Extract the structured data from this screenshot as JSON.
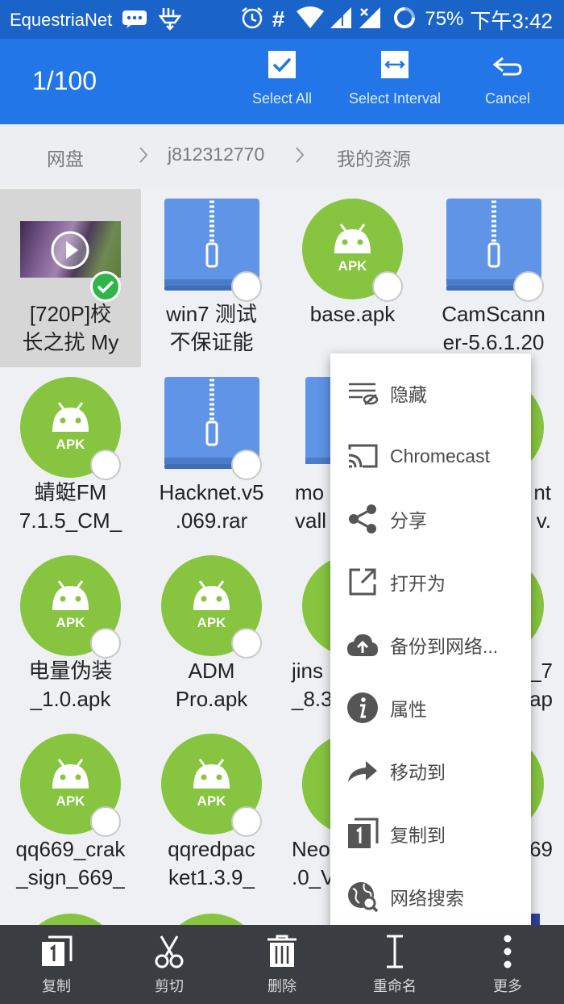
{
  "status_bar": {
    "carrier": "EquestriaNet",
    "battery": "75%",
    "time": "下午3:42",
    "hash": "#"
  },
  "action_bar": {
    "count": "1/100",
    "select_all": "Select All",
    "select_interval": "Select Interval",
    "cancel": "Cancel"
  },
  "breadcrumb": [
    "网盘",
    "j812312770",
    "我的资源"
  ],
  "files": [
    {
      "name": "[720P]校\n长之扰 My",
      "type": "video",
      "selected": true
    },
    {
      "name": "win7 测试\n不保证能",
      "type": "zip"
    },
    {
      "name": "base.apk",
      "type": "apk"
    },
    {
      "name": "CamScann\ner-5.6.1.20",
      "type": "zip"
    },
    {
      "name": "蜻蜓FM\n7.1.5_CM_",
      "type": "apk"
    },
    {
      "name": "Hacknet.v5\n.069.rar",
      "type": "zip"
    },
    {
      "name": "mo\nvall",
      "type": "zip"
    },
    {
      "name": "nt\nv.",
      "type": "apk"
    },
    {
      "name": "电量伪装\n_1.0.apk",
      "type": "apk"
    },
    {
      "name": "ADM\nPro.apk",
      "type": "apk"
    },
    {
      "name": "jins\n_8.3",
      "type": "apk"
    },
    {
      "name": "_7\nap",
      "type": "apk"
    },
    {
      "name": "qq669_crak\n_sign_669_",
      "type": "apk"
    },
    {
      "name": "qqredpac\nket1.3.9_",
      "type": "apk"
    },
    {
      "name": "Neo\n.0_V",
      "type": "apk"
    },
    {
      "name": "69",
      "type": "apk"
    }
  ],
  "menu": [
    {
      "label": "隐藏",
      "icon": "hide-icon"
    },
    {
      "label": "Chromecast",
      "icon": "cast-icon"
    },
    {
      "label": "分享",
      "icon": "share-icon"
    },
    {
      "label": "打开为",
      "icon": "open-as-icon"
    },
    {
      "label": "备份到网络...",
      "icon": "cloud-upload-icon"
    },
    {
      "label": "属性",
      "icon": "info-icon"
    },
    {
      "label": "移动到",
      "icon": "move-icon"
    },
    {
      "label": "复制到",
      "icon": "copy-to-icon"
    },
    {
      "label": "网络搜索",
      "icon": "web-search-icon"
    }
  ],
  "bottom_bar": {
    "copy": "复制",
    "cut": "剪切",
    "delete": "删除",
    "rename": "重命名",
    "more": "更多"
  },
  "colors": {
    "status_bar": "#1a63c9",
    "action_bar": "#2276e8",
    "apk_green": "#87c540",
    "zip_blue": "#5f94e6",
    "check_green": "#2fb54a",
    "bottom_bar": "#3a3d42"
  }
}
